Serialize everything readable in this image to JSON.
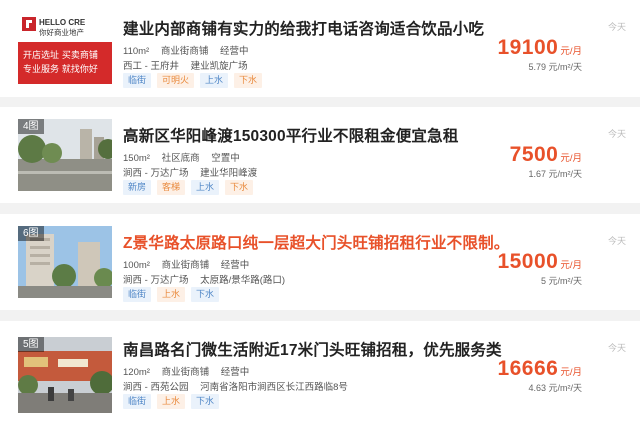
{
  "listings": [
    {
      "photo_count": "",
      "title": "建业内部商铺有实力的给我打电话咨询适合饮品小吃",
      "title_highlight": false,
      "area": "110m²",
      "type": "商业街商铺",
      "status": "经营中",
      "district": "西工 - 王府井",
      "address": "建业凯旋广场",
      "tags": [
        {
          "label": "临街",
          "style": "blue"
        },
        {
          "label": "可明火",
          "style": "orange"
        },
        {
          "label": "上水",
          "style": "blue"
        },
        {
          "label": "下水",
          "style": "orange"
        }
      ],
      "price": "19100",
      "price_unit": "元/月",
      "price_per": "5.79 元/m²/天",
      "date": "今天",
      "ad": {
        "brand": "HELLO CRE",
        "brand_sub": "你好商业地产",
        "line1": "开店选址  买卖商铺",
        "line2": "专业服务  就找你好"
      }
    },
    {
      "photo_count": "4图",
      "title": "高新区华阳峰渡150300平行业不限租金便宜急租",
      "title_highlight": false,
      "area": "150m²",
      "type": "社区底商",
      "status": "空置中",
      "district": "涧西 - 万达广场",
      "address": "建业华阳峰渡",
      "tags": [
        {
          "label": "新房",
          "style": "blue"
        },
        {
          "label": "客梯",
          "style": "orange"
        },
        {
          "label": "上水",
          "style": "blue"
        },
        {
          "label": "下水",
          "style": "orange"
        }
      ],
      "price": "7500",
      "price_unit": "元/月",
      "price_per": "1.67 元/m²/天",
      "date": "今天"
    },
    {
      "photo_count": "6图",
      "title": "Z景华路太原路口纯一层超大门头旺铺招租行业不限制。",
      "title_highlight": true,
      "area": "100m²",
      "type": "商业街商铺",
      "status": "经营中",
      "district": "涧西 - 万达广场",
      "address": "太原路/景华路(路口)",
      "tags": [
        {
          "label": "临街",
          "style": "blue"
        },
        {
          "label": "上水",
          "style": "orange"
        },
        {
          "label": "下水",
          "style": "blue"
        }
      ],
      "price": "15000",
      "price_unit": "元/月",
      "price_per": "5 元/m²/天",
      "date": "今天"
    },
    {
      "photo_count": "5图",
      "title": "南昌路名门微生活附近17米门头旺铺招租，优先服务类",
      "title_highlight": false,
      "area": "120m²",
      "type": "商业街商铺",
      "status": "经营中",
      "district": "涧西 - 西苑公园",
      "address": "河南省洛阳市涧西区长江西路临8号",
      "tags": [
        {
          "label": "临街",
          "style": "blue"
        },
        {
          "label": "上水",
          "style": "orange"
        },
        {
          "label": "下水",
          "style": "blue"
        }
      ],
      "price": "16666",
      "price_unit": "元/月",
      "price_per": "4.63 元/m²/天",
      "date": "今天"
    }
  ]
}
